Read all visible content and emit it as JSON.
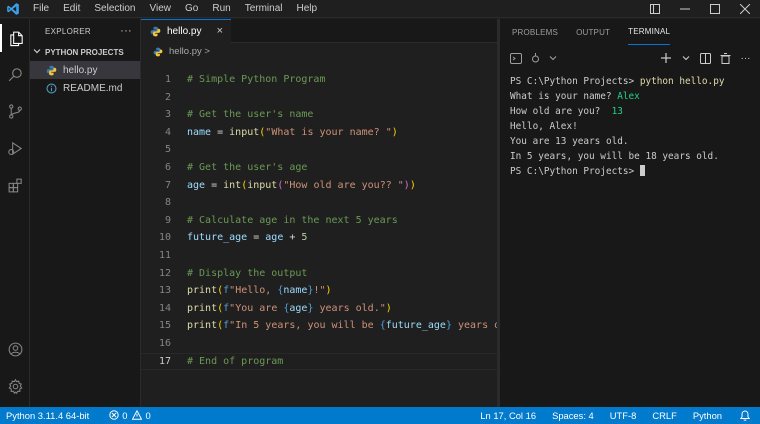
{
  "menu": [
    "File",
    "Edit",
    "Selection",
    "View",
    "Go",
    "Run",
    "Terminal",
    "Help"
  ],
  "sidebar": {
    "header": "EXPLORER",
    "folder": "PYTHON PROJECTS",
    "files": [
      {
        "name": "hello.py",
        "icon": "python-icon",
        "selected": true
      },
      {
        "name": "README.md",
        "icon": "info-icon",
        "selected": false
      }
    ]
  },
  "editor": {
    "tab": {
      "label": "hello.py",
      "close": "×"
    },
    "breadcrumb": "hello.py >",
    "current_line": 17,
    "lines": [
      {
        "n": "1",
        "tokens": [
          [
            "# Simple Python Program",
            "c-com"
          ]
        ]
      },
      {
        "n": "2",
        "tokens": []
      },
      {
        "n": "3",
        "tokens": [
          [
            "# Get the user's name",
            "c-com"
          ]
        ]
      },
      {
        "n": "4",
        "tokens": [
          [
            "name",
            "c-var"
          ],
          [
            " = ",
            "c-op"
          ],
          [
            "input",
            "c-fn"
          ],
          [
            "(",
            "c-br"
          ],
          [
            "\"What is your name? \"",
            "c-str"
          ],
          [
            ")",
            "c-br"
          ]
        ]
      },
      {
        "n": "5",
        "tokens": []
      },
      {
        "n": "6",
        "tokens": [
          [
            "# Get the user's age",
            "c-com"
          ]
        ]
      },
      {
        "n": "7",
        "tokens": [
          [
            "age",
            "c-var"
          ],
          [
            " = ",
            "c-op"
          ],
          [
            "int",
            "c-fn"
          ],
          [
            "(",
            "c-br"
          ],
          [
            "input",
            "c-fn"
          ],
          [
            "(",
            "c-br2"
          ],
          [
            "\"How old are you?? \"",
            "c-str"
          ],
          [
            ")",
            "c-br2"
          ],
          [
            ")",
            "c-br"
          ]
        ]
      },
      {
        "n": "8",
        "tokens": []
      },
      {
        "n": "9",
        "tokens": [
          [
            "# Calculate age in the next 5 years",
            "c-com"
          ]
        ]
      },
      {
        "n": "10",
        "tokens": [
          [
            "future_age",
            "c-var"
          ],
          [
            " = ",
            "c-op"
          ],
          [
            "age",
            "c-var"
          ],
          [
            " + ",
            "c-op"
          ],
          [
            "5",
            "c-num"
          ]
        ]
      },
      {
        "n": "11",
        "tokens": []
      },
      {
        "n": "12",
        "tokens": [
          [
            "# Display the output",
            "c-com"
          ]
        ]
      },
      {
        "n": "13",
        "tokens": [
          [
            "print",
            "c-fn"
          ],
          [
            "(",
            "c-br"
          ],
          [
            "f",
            "c-fmt"
          ],
          [
            "\"Hello, ",
            "c-str"
          ],
          [
            "{",
            "c-fmt"
          ],
          [
            "name",
            "c-ivar"
          ],
          [
            "}",
            "c-fmt"
          ],
          [
            "!\"",
            "c-str"
          ],
          [
            ")",
            "c-br"
          ]
        ]
      },
      {
        "n": "14",
        "tokens": [
          [
            "print",
            "c-fn"
          ],
          [
            "(",
            "c-br"
          ],
          [
            "f",
            "c-fmt"
          ],
          [
            "\"You are ",
            "c-str"
          ],
          [
            "{",
            "c-fmt"
          ],
          [
            "age",
            "c-ivar"
          ],
          [
            "}",
            "c-fmt"
          ],
          [
            " years old.\"",
            "c-str"
          ],
          [
            ")",
            "c-br"
          ]
        ]
      },
      {
        "n": "15",
        "tokens": [
          [
            "print",
            "c-fn"
          ],
          [
            "(",
            "c-br"
          ],
          [
            "f",
            "c-fmt"
          ],
          [
            "\"In 5 years, you will be ",
            "c-str"
          ],
          [
            "{",
            "c-fmt"
          ],
          [
            "future_age",
            "c-ivar"
          ],
          [
            "}",
            "c-fmt"
          ],
          [
            " years old.\"",
            "c-str"
          ],
          [
            ")",
            "c-br"
          ]
        ]
      },
      {
        "n": "16",
        "tokens": []
      },
      {
        "n": "17",
        "tokens": [
          [
            "# End of program",
            "c-com"
          ]
        ]
      }
    ]
  },
  "panel": {
    "tabs": [
      "PROBLEMS",
      "OUTPUT",
      "TERMINAL"
    ],
    "active_tab": "TERMINAL",
    "terminal": [
      [
        [
          "PS C:\\Python Projects> ",
          ""
        ],
        [
          "python hello.py",
          "t-cmd"
        ]
      ],
      [
        [
          "What is your name? ",
          ""
        ],
        [
          "Alex",
          "t-in"
        ]
      ],
      [
        [
          "How old are you?  ",
          ""
        ],
        [
          "13",
          "t-in"
        ]
      ],
      [
        [
          "Hello, Alex!",
          ""
        ]
      ],
      [
        [
          "You are 13 years old.",
          ""
        ]
      ],
      [
        [
          "In 5 years, you will be 18 years old.",
          ""
        ]
      ],
      [
        [
          "PS C:\\Python Projects> ",
          ""
        ]
      ]
    ]
  },
  "statusbar": {
    "python": "Python 3.11.4  64-bit",
    "errors": "0",
    "warnings": "0",
    "position": "Ln 17, Col 16",
    "spaces": "Spaces: 4",
    "encoding": "UTF-8",
    "eol": "CRLF",
    "language": "Python"
  },
  "colors": {
    "accent": "#0078d4",
    "statusbar": "#007acc",
    "background": "#1e1e1e"
  }
}
